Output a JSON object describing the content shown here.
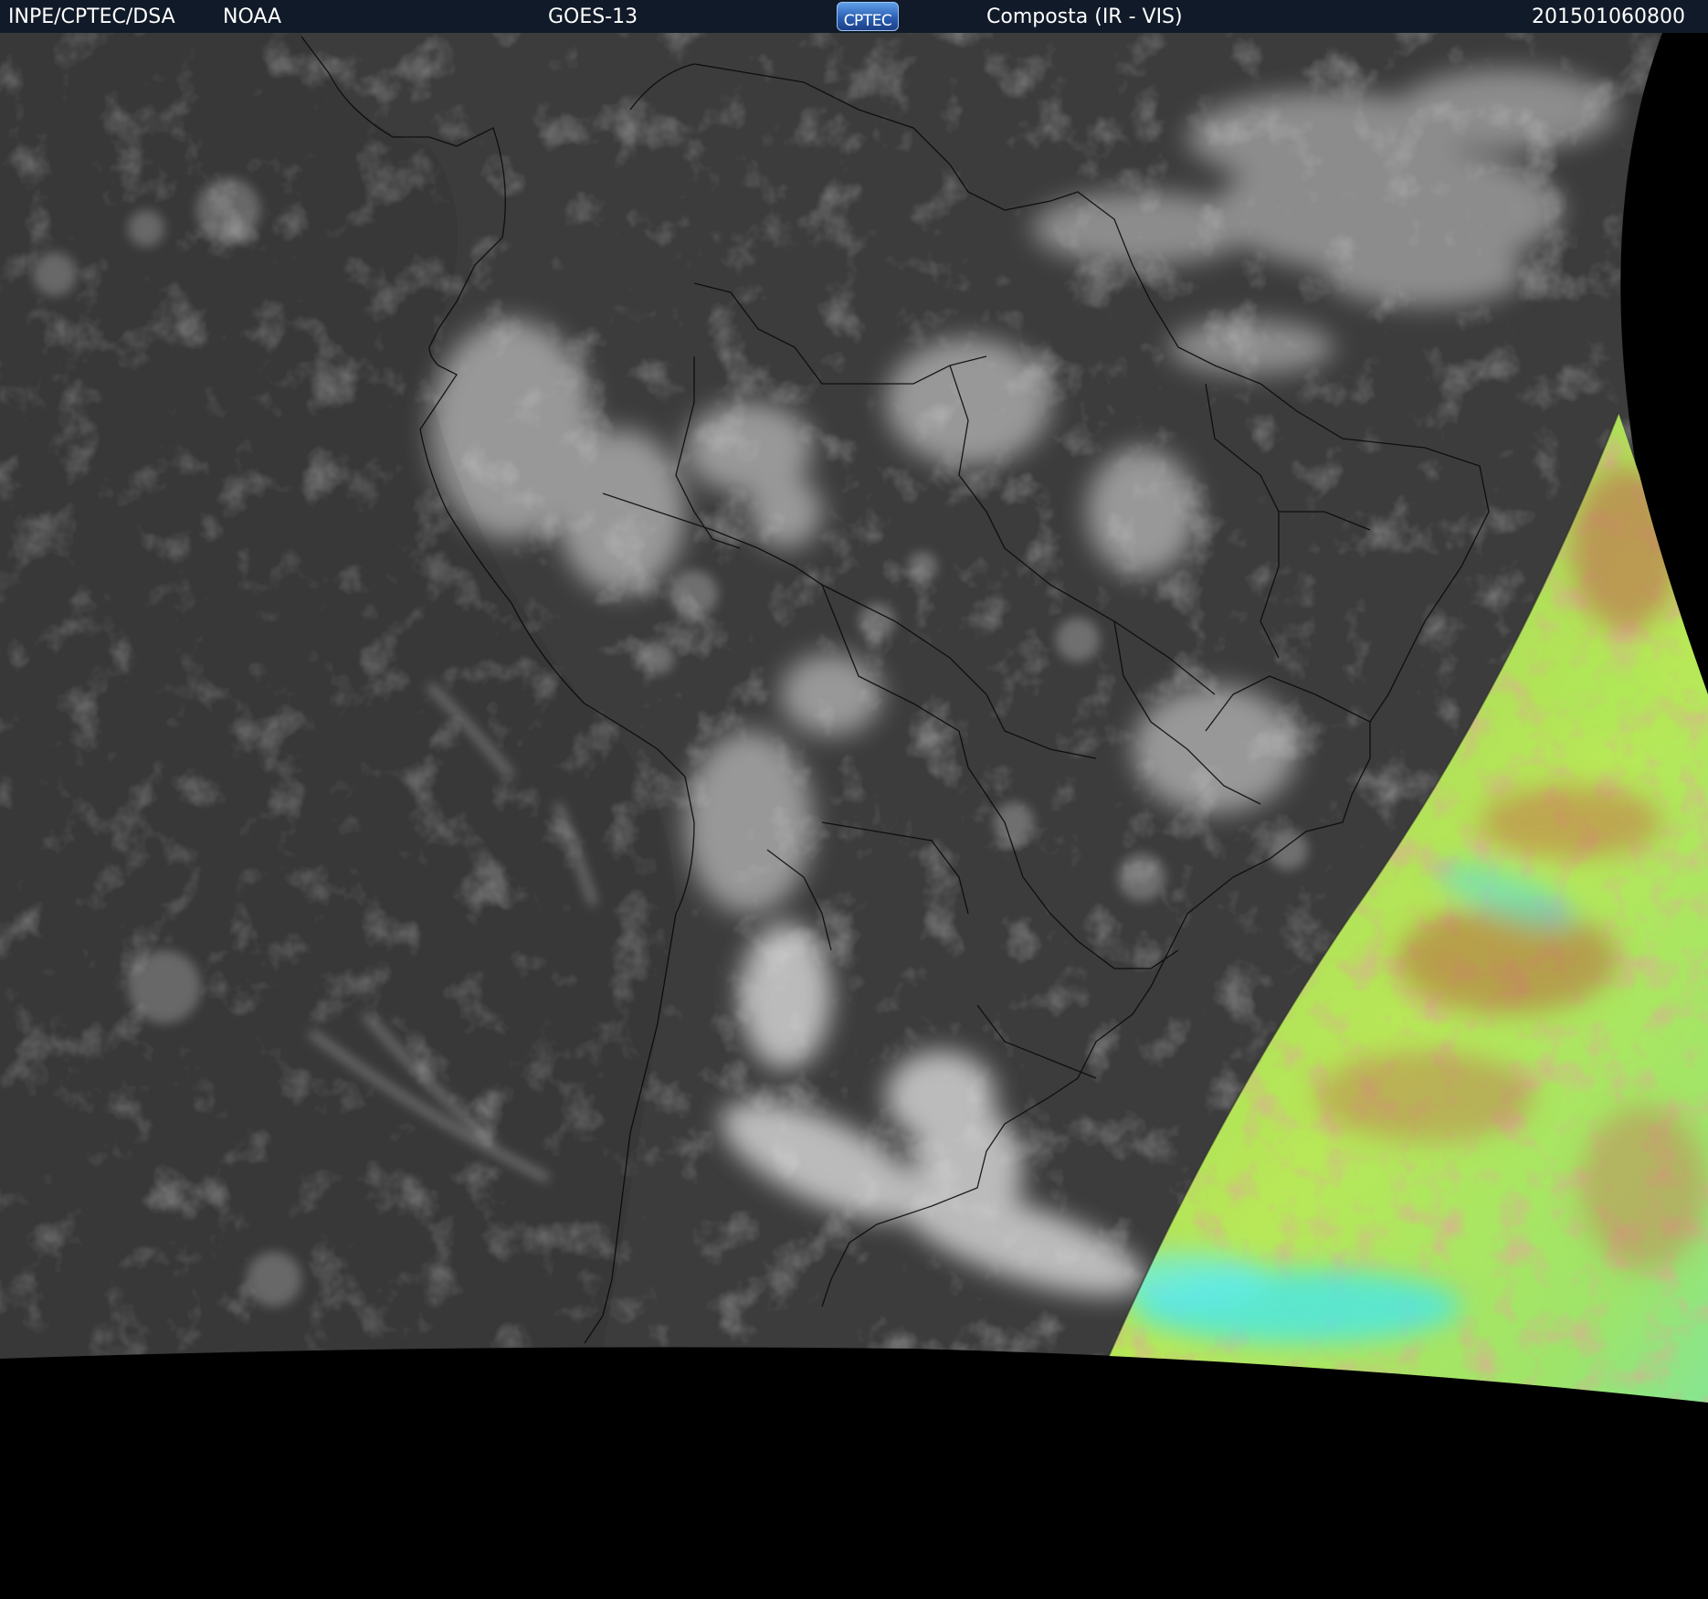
{
  "header": {
    "source": "INPE/CPTEC/DSA",
    "agency": "NOAA",
    "satellite": "GOES-13",
    "logo_text": "CPTEC",
    "product": "Composta (IR - VIS)",
    "timestamp": "201501060800"
  },
  "colors": {
    "header_background": "#111a28",
    "header_text": "#ffffff",
    "ir_background": "#3c3c3c",
    "cloud_gray": "#bdbdbd",
    "space_black": "#000000",
    "vis_green": "#a6e65c",
    "vis_brown": "#b86a4a",
    "vis_cyan": "#4de8e0",
    "border_lines": "#0a0a0a"
  },
  "image": {
    "type": "satellite-composite",
    "region": "South America",
    "left_panel": "infrared grayscale",
    "right_panel": "visible false-color"
  }
}
